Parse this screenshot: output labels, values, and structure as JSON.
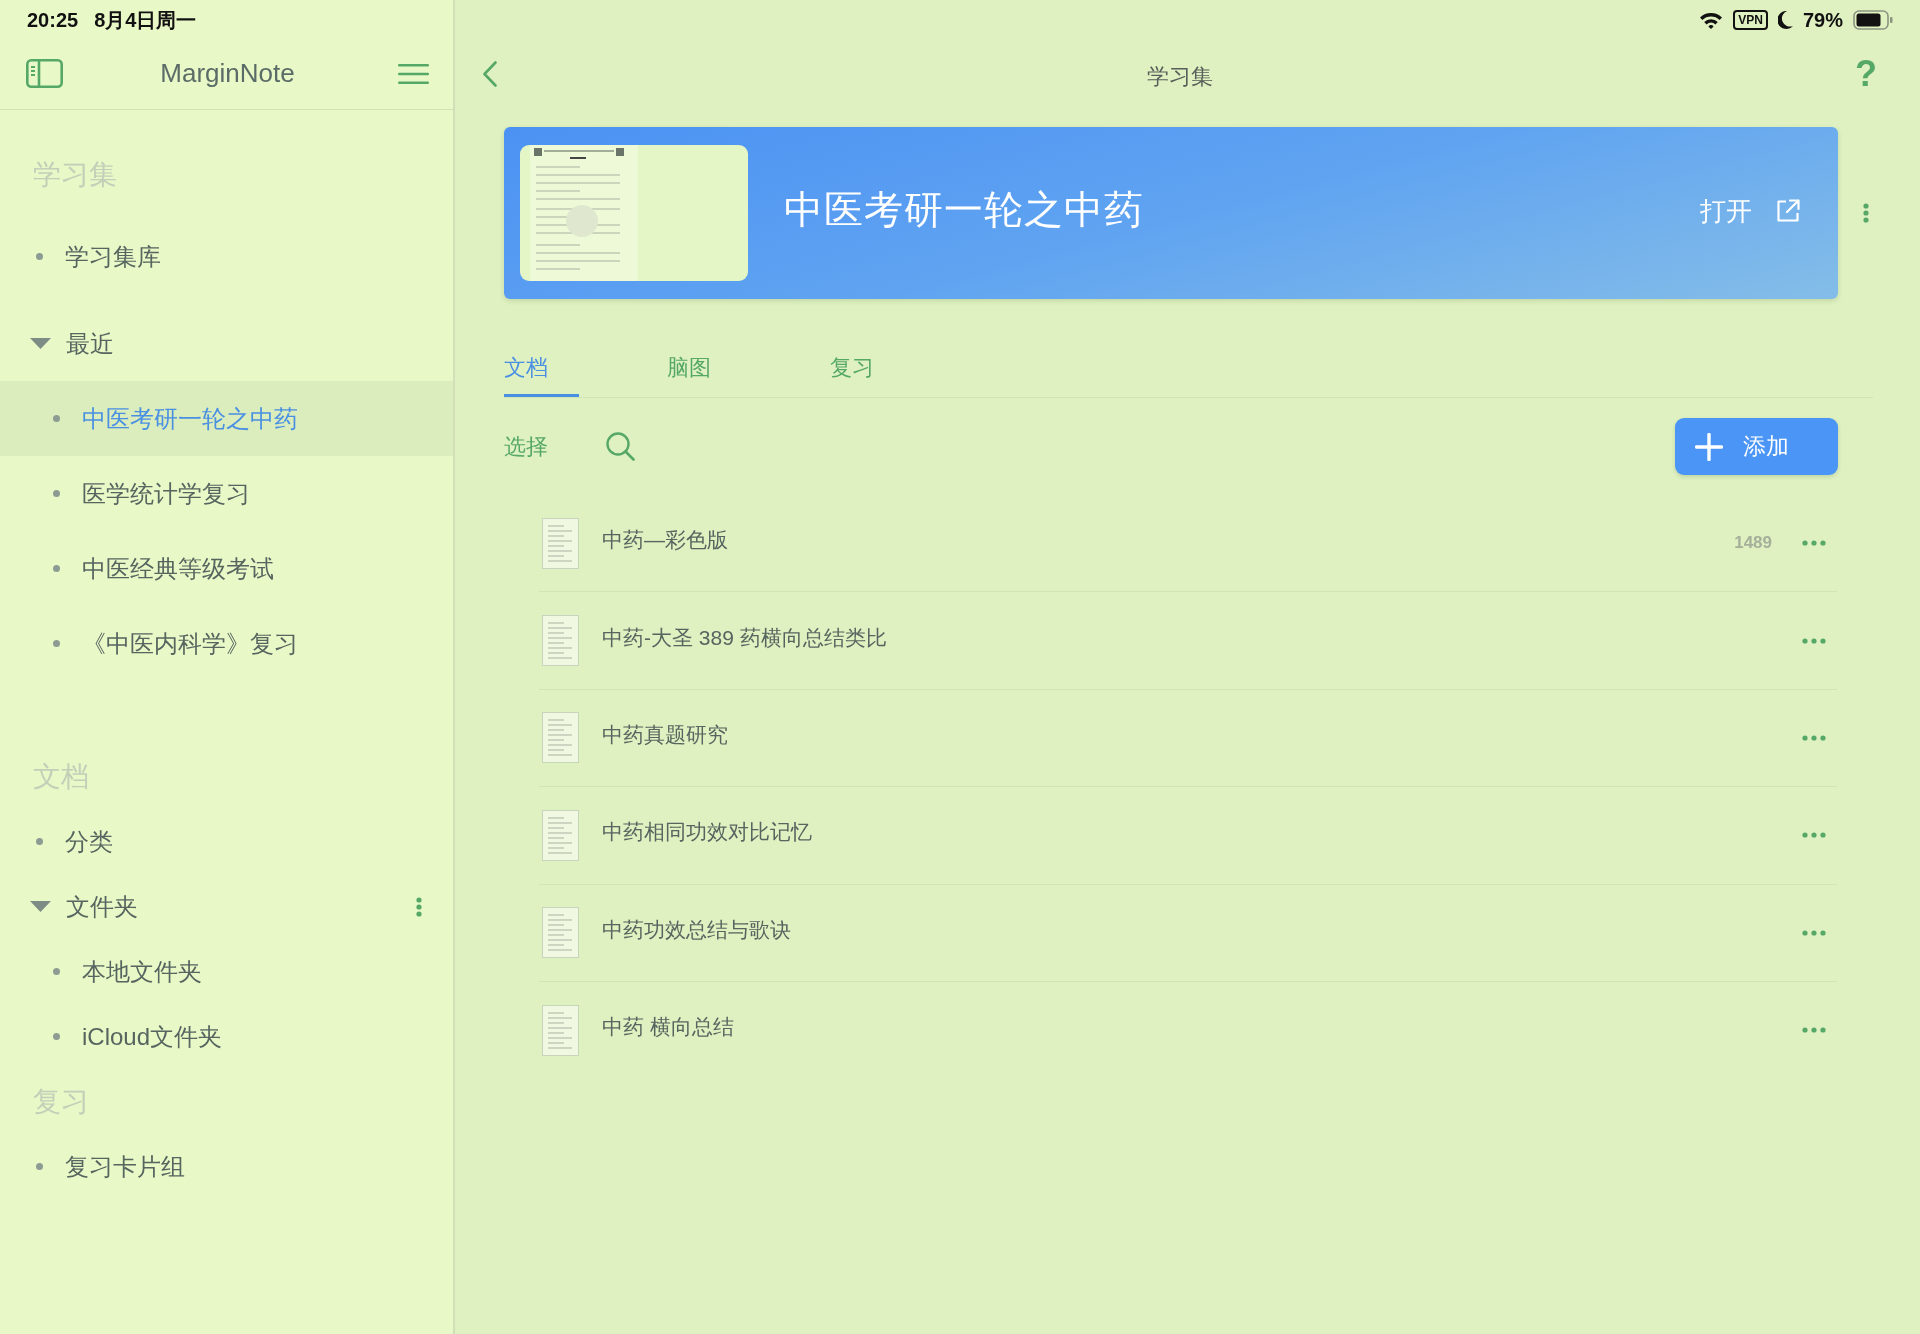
{
  "status_bar": {
    "time": "20:25",
    "date": "8月4日周一",
    "vpn": "VPN",
    "battery": "79%"
  },
  "sidebar": {
    "title": "MarginNote",
    "sections": [
      {
        "title": "学习集",
        "items": [
          {
            "kind": "link",
            "label": "学习集库"
          },
          {
            "kind": "group",
            "label": "最近",
            "expanded": true,
            "more": false,
            "children": [
              {
                "label": "中医考研一轮之中药",
                "selected": true
              },
              {
                "label": "医学统计学复习",
                "selected": false
              },
              {
                "label": "中医经典等级考试",
                "selected": false
              },
              {
                "label": "《中医内科学》复习",
                "selected": false
              }
            ]
          }
        ]
      },
      {
        "title": "文档",
        "items": [
          {
            "kind": "link",
            "label": "分类"
          },
          {
            "kind": "group",
            "label": "文件夹",
            "expanded": true,
            "more": true,
            "children": [
              {
                "label": "本地文件夹",
                "selected": false
              },
              {
                "label": "iCloud文件夹",
                "selected": false
              }
            ]
          }
        ]
      },
      {
        "title": "复习",
        "items": [
          {
            "kind": "link",
            "label": "复习卡片组"
          }
        ]
      }
    ]
  },
  "main": {
    "title": "学习集",
    "help": "?",
    "banner": {
      "title": "中医考研一轮之中药",
      "open_label": "打开"
    },
    "tabs": [
      {
        "label": "文档",
        "selected": true
      },
      {
        "label": "脑图",
        "selected": false
      },
      {
        "label": "复习",
        "selected": false
      }
    ],
    "toolbar": {
      "select_label": "选择",
      "add_label": "添加"
    },
    "documents": [
      {
        "title": "中药—彩色版",
        "count": "1489"
      },
      {
        "title": "中药-大圣 389 药横向总结类比"
      },
      {
        "title": "中药真题研究"
      },
      {
        "title": "中药相同功效对比记忆"
      },
      {
        "title": "中药功效总结与歌诀"
      },
      {
        "title": "中药 横向总结"
      }
    ]
  }
}
